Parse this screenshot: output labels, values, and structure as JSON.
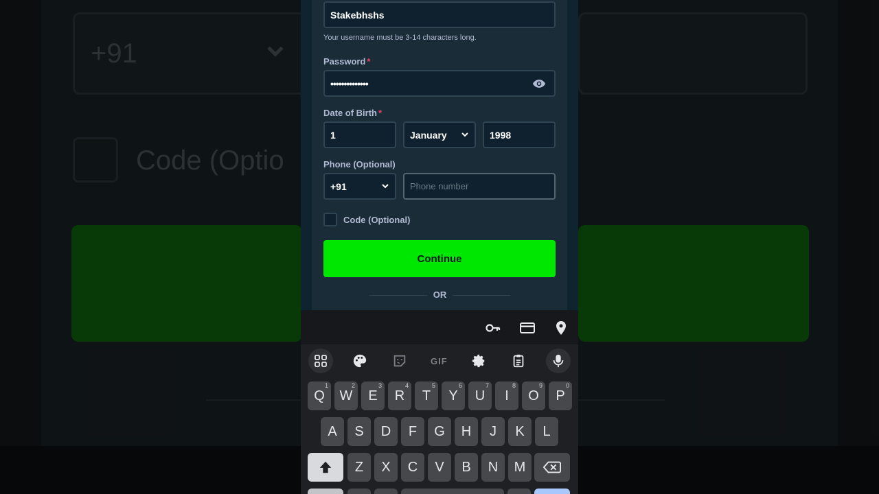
{
  "background": {
    "phone_code": "+91",
    "code_label": "Code (Optio"
  },
  "form": {
    "username": {
      "value": "Stakebhshs",
      "hint": "Your username must be 3-14 characters long."
    },
    "password": {
      "label": "Password",
      "required": "*",
      "masked_value": "••••••••••••••"
    },
    "dob": {
      "label": "Date of Birth",
      "required": "*",
      "day": "1",
      "month": "January",
      "year": "1998"
    },
    "phone": {
      "label": "Phone (Optional)",
      "country_code": "+91",
      "placeholder": "Phone number"
    },
    "code": {
      "label": "Code (Optional)",
      "checked": false
    },
    "continue_label": "Continue",
    "or_label": "OR"
  },
  "keyboard": {
    "gif_label": "GIF",
    "row1": [
      {
        "k": "Q",
        "n": "1"
      },
      {
        "k": "W",
        "n": "2"
      },
      {
        "k": "E",
        "n": "3"
      },
      {
        "k": "R",
        "n": "4"
      },
      {
        "k": "T",
        "n": "5"
      },
      {
        "k": "Y",
        "n": "6"
      },
      {
        "k": "U",
        "n": "7"
      },
      {
        "k": "I",
        "n": "8"
      },
      {
        "k": "O",
        "n": "9"
      },
      {
        "k": "P",
        "n": "0"
      }
    ],
    "row2": [
      "A",
      "S",
      "D",
      "F",
      "G",
      "H",
      "J",
      "K",
      "L"
    ],
    "row3": [
      "Z",
      "X",
      "C",
      "V",
      "B",
      "N",
      "M"
    ]
  },
  "colors": {
    "accent_green": "#00e701",
    "form_bg": "#1a2c38",
    "input_bg": "#0f212e",
    "required_red": "#ed4163"
  },
  "icons": {
    "autofill": [
      "key-icon",
      "credit-card-icon",
      "location-pin-icon"
    ],
    "toolbar": [
      "apps-grid-icon",
      "palette-icon",
      "sticker-icon",
      "gif-icon",
      "settings-gear-icon",
      "clipboard-icon",
      "microphone-icon"
    ],
    "password_toggle": "eye-icon",
    "shift": "shift-arrow-icon",
    "backspace": "backspace-icon"
  }
}
